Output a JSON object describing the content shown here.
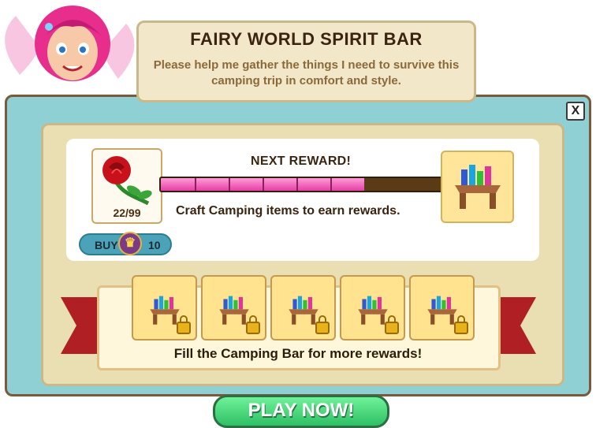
{
  "header": {
    "title": "FAIRY WORLD SPIRIT BAR",
    "description": "Please help me gather the things I need to survive this camping trip in comfort and style."
  },
  "close_label": "X",
  "progress": {
    "label": "NEXT REWARD!",
    "fill_fraction": 0.72,
    "segments": 6,
    "instruction": "Craft Camping items to earn rewards."
  },
  "item": {
    "icon": "rose-icon",
    "count": "22/99"
  },
  "buy": {
    "label": "BUY",
    "currency_icon": "crown-icon",
    "price": "10"
  },
  "next_reward_icon": "crystal-table-icon",
  "locked_rewards": {
    "icons": [
      "crystal-table-icon",
      "crystal-table-icon",
      "crystal-table-icon",
      "crystal-table-icon",
      "crystal-table-icon"
    ],
    "footer": "Fill the Camping  Bar for more rewards!"
  },
  "play_button": "PLAY NOW!",
  "colors": {
    "frame": "#8fd0d4",
    "bar_fill": "#e53fa6",
    "play": "#2fbf64",
    "banner": "#b01f23"
  }
}
